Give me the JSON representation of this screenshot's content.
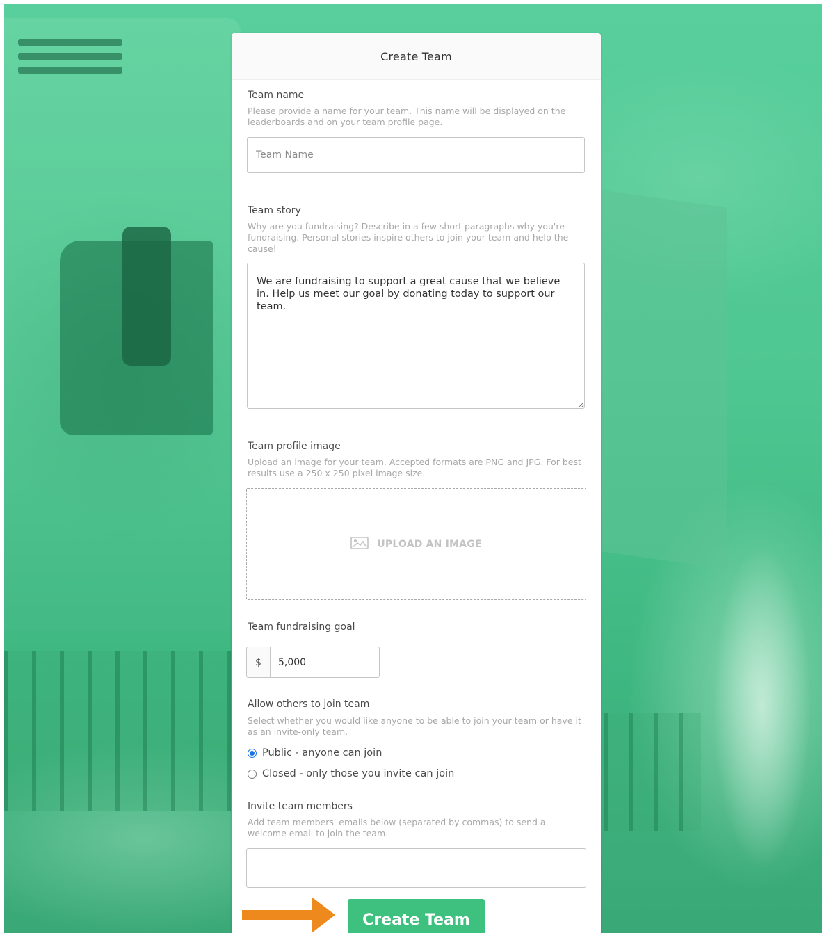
{
  "form": {
    "title": "Create Team",
    "team_name": {
      "label": "Team name",
      "help": "Please provide a name for your team. This name will be displayed on the leaderboards and on your team profile page.",
      "placeholder": "Team Name",
      "value": ""
    },
    "team_story": {
      "label": "Team story",
      "help": "Why are you fundraising? Describe in a few short paragraphs why you're fundraising. Personal stories inspire others to join your team and help the cause!",
      "value": "We are fundraising to support a great cause that we believe in. Help us meet our goal by donating today to support our team."
    },
    "profile_image": {
      "label": "Team profile image",
      "help": "Upload an image for your team. Accepted formats are PNG and JPG. For best results use a 250 x 250 pixel image size.",
      "upload_label": "UPLOAD AN IMAGE",
      "icon": "image-icon"
    },
    "goal": {
      "label": "Team fundraising goal",
      "currency": "$",
      "value": "5,000"
    },
    "join": {
      "label": "Allow others to join team",
      "help": "Select whether you would like anyone to be able to join your team or have it as an invite-only team.",
      "options": [
        {
          "label": "Public - anyone can join",
          "checked": true
        },
        {
          "label": "Closed - only those you invite can join",
          "checked": false
        }
      ]
    },
    "invite": {
      "label": "Invite team members",
      "help": "Add team members' emails below (separated by commas) to send a welcome email to join the team.",
      "value": ""
    },
    "submit_label": "Create Team"
  },
  "colors": {
    "accent_green": "#3ec07f",
    "arrow_orange": "#ee8a1d",
    "radio_blue": "#1a73e8"
  }
}
